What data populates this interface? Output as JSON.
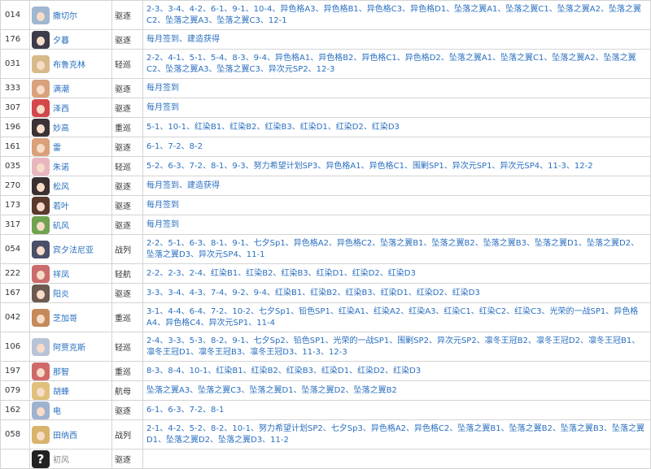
{
  "rows": [
    {
      "id": "014",
      "name": "撒切尔",
      "type": "驱逐",
      "loc": "2-3、3-4、4-2、6-1、9-1、10-4、异色格A3、异色格B1、异色格C3、异色格D1、坠落之翼A1、坠落之翼C1、坠落之翼A2、坠落之翼C2、坠落之翼A3、坠落之翼C3、12-1",
      "h": 36,
      "color": "#9fb7cf"
    },
    {
      "id": "176",
      "name": "夕暮",
      "type": "驱逐",
      "loc": "每月签到、建造获得",
      "h": 24,
      "color": "#3b3b4a"
    },
    {
      "id": "031",
      "name": "布鲁克林",
      "type": "轻巡",
      "loc": "2-2、4-1、5-1、5-4、8-3、9-4、异色格A1、异色格B2、异色格C1、异色格D2、坠落之翼A1、坠落之翼C1、坠落之翼A2、坠落之翼C2、坠落之翼A3、坠落之翼C3、异次元SP2、12-3",
      "h": 36,
      "color": "#d7b98a"
    },
    {
      "id": "333",
      "name": "满潮",
      "type": "驱逐",
      "loc": "每月签到",
      "h": 24,
      "color": "#d9a17c"
    },
    {
      "id": "307",
      "name": "泽西",
      "type": "驱逐",
      "loc": "每月签到",
      "h": 24,
      "color": "#d4474b"
    },
    {
      "id": "196",
      "name": "妙高",
      "type": "重巡",
      "loc": "5-1、10-1、红染B1、红染B2、红染B3、红染D1、红染D2、红染D3",
      "h": 24,
      "color": "#3a3236"
    },
    {
      "id": "161",
      "name": "雷",
      "type": "驱逐",
      "loc": "6-1、7-2、8-2",
      "h": 24,
      "color": "#d9a07a"
    },
    {
      "id": "035",
      "name": "朱诺",
      "type": "轻巡",
      "loc": "5-2、6-3、7-2、8-1、9-3、努力希望计划SP3、异色格A1、异色格C1、围剿SP1、异次元SP1、异次元SP4、11-3、12-2",
      "h": 24,
      "color": "#e9b6bf"
    },
    {
      "id": "270",
      "name": "松风",
      "type": "驱逐",
      "loc": "每月签到、建造获得",
      "h": 24,
      "color": "#3b3030"
    },
    {
      "id": "173",
      "name": "若叶",
      "type": "驱逐",
      "loc": "每月签到",
      "h": 24,
      "color": "#5a3a2c"
    },
    {
      "id": "317",
      "name": "矶风",
      "type": "驱逐",
      "loc": "每月签到",
      "h": 24,
      "color": "#6fa34f"
    },
    {
      "id": "054",
      "name": "宾夕法尼亚",
      "type": "战列",
      "loc": "2-2、5-1、6-3、8-1、9-1、七夕Sp1、异色格A2、异色格C2、坠落之翼B1、坠落之翼B2、坠落之翼B3、坠落之翼D1、坠落之翼D2、坠落之翼D3、异次元SP4、11-1",
      "h": 36,
      "color": "#4a4f6a"
    },
    {
      "id": "222",
      "name": "祥凤",
      "type": "轻航",
      "loc": "2-2、2-3、2-4、红染B1、红染B2、红染B3、红染D1、红染D2、红染D3",
      "h": 24,
      "color": "#cc6b6b"
    },
    {
      "id": "167",
      "name": "阳炎",
      "type": "驱逐",
      "loc": "3-3、3-4、4-3、7-4、9-2、9-4、红染B1、红染B2、红染B3、红染D1、红染D2、红染D3",
      "h": 24,
      "color": "#6b5a4f"
    },
    {
      "id": "042",
      "name": "芝加哥",
      "type": "重巡",
      "loc": "3-1、4-4、6-4、7-2、10-2、七夕Sp1、铅色SP1、红染A1、红染A2、红染A3、红染C1、红染C2、红染C3、光荣的一战SP1、异色格A4、异色格C4、异次元SP1、11-4",
      "h": 36,
      "color": "#c58a5a"
    },
    {
      "id": "106",
      "name": "阿贾克斯",
      "type": "轻巡",
      "loc": "2-4、3-3、5-3、8-2、9-1、七夕Sp2、铅色SP1、光荣的一战SP1、围剿SP2、异次元SP2、凛冬王冠B2、凛冬王冠D2、凛冬王冠B1、凛冬王冠D1、凛冬王冠B3、凛冬王冠D3、11-3、12-3",
      "h": 36,
      "color": "#b9c3d8"
    },
    {
      "id": "197",
      "name": "那智",
      "type": "重巡",
      "loc": "8-3、8-4、10-1、红染B1、红染B2、红染B3、红染D1、红染D2、红染D3",
      "h": 24,
      "color": "#d06a6a"
    },
    {
      "id": "079",
      "name": "胡蜂",
      "type": "航母",
      "loc": "坠落之翼A3、坠落之翼C3、坠落之翼D1、坠落之翼D2、坠落之翼B2",
      "h": 24,
      "color": "#e0c07a"
    },
    {
      "id": "162",
      "name": "电",
      "type": "驱逐",
      "loc": "6-1、6-3、7-2、8-1",
      "h": 24,
      "color": "#9fb2cf"
    },
    {
      "id": "058",
      "name": "田纳西",
      "type": "战列",
      "loc": "2-1、4-2、5-2、8-2、10-1、努力希望计划SP2、七夕Sp3、异色格A2、异色格C2、坠落之翼B1、坠落之翼B2、坠落之翼B3、坠落之翼D1、坠落之翼D2、坠落之翼D3、11-2",
      "h": 36,
      "color": "#d9b36a"
    },
    {
      "id": "",
      "name": "初风",
      "type": "驱逐",
      "loc": "",
      "h": 24,
      "color": "#222222",
      "unknown": true,
      "qmark": "?"
    }
  ]
}
